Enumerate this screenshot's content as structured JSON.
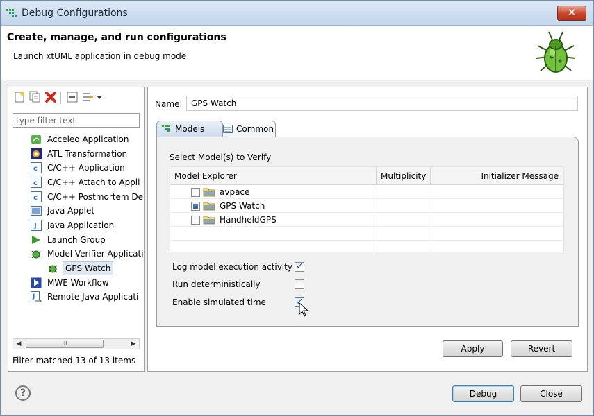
{
  "window": {
    "title": "Debug Configurations",
    "close_label": "✕"
  },
  "header": {
    "title": "Create, manage, and run configurations",
    "subtitle": "Launch xtUML application in debug mode"
  },
  "left_panel": {
    "filter_placeholder": "type filter text",
    "tree_items": [
      {
        "label": "Acceleo Application",
        "icon": "acceleo-icon"
      },
      {
        "label": "ATL Transformation",
        "icon": "atl-icon"
      },
      {
        "label": "C/C++ Application",
        "icon": "c-app-icon"
      },
      {
        "label": "C/C++ Attach to Appli",
        "icon": "c-app-icon"
      },
      {
        "label": "C/C++ Postmortem De",
        "icon": "c-app-icon"
      },
      {
        "label": "Java Applet",
        "icon": "java-applet-icon"
      },
      {
        "label": "Java Application",
        "icon": "java-app-icon"
      },
      {
        "label": "Launch Group",
        "icon": "launch-group-icon"
      },
      {
        "label": "Model Verifier Applicati",
        "icon": "model-verifier-icon"
      },
      {
        "label": "GPS Watch",
        "icon": "model-verifier-icon",
        "selected": true
      },
      {
        "label": "MWE Workflow",
        "icon": "mwe-icon"
      },
      {
        "label": "Remote Java Applicati",
        "icon": "remote-java-icon"
      }
    ],
    "scroll_thumb_label": "III",
    "status": "Filter matched 13 of 13 items"
  },
  "config": {
    "name_label": "Name:",
    "name_value": "GPS Watch",
    "tabs": [
      {
        "label": "Models",
        "active": true
      },
      {
        "label": "Common",
        "active": false
      }
    ],
    "select_label": "Select Model(s) to Verify",
    "table": {
      "columns": [
        "Model Explorer",
        "Multiplicity",
        "Initializer Message"
      ],
      "rows": [
        {
          "label": "avpace",
          "state": "unchecked"
        },
        {
          "label": "GPS Watch",
          "state": "partial"
        },
        {
          "label": "HandheldGPS",
          "state": "unchecked"
        }
      ]
    },
    "options": [
      {
        "label": "Log model execution activity",
        "checked": true
      },
      {
        "label": "Run deterministically",
        "checked": false
      },
      {
        "label": "Enable simulated time",
        "checked": true
      }
    ],
    "apply_label": "Apply",
    "revert_label": "Revert"
  },
  "footer": {
    "help_label": "?",
    "debug_label": "Debug",
    "close_label": "Close"
  }
}
